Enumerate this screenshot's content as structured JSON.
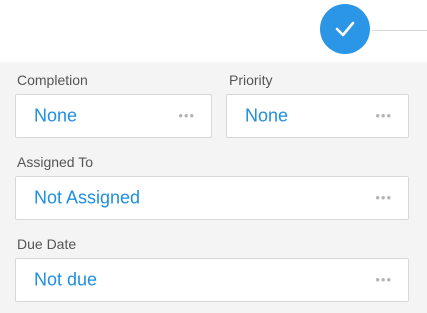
{
  "confirm": {
    "icon": "checkmark-icon",
    "color": "#2b95e6"
  },
  "fields": {
    "completion": {
      "label": "Completion",
      "value": "None",
      "more": "•••"
    },
    "priority": {
      "label": "Priority",
      "value": "None",
      "more": "•••"
    },
    "assigned_to": {
      "label": "Assigned To",
      "value": "Not Assigned",
      "more": "•••"
    },
    "due_date": {
      "label": "Due Date",
      "value": "Not due",
      "more": "•••"
    }
  },
  "colors": {
    "accent": "#1f8fe0",
    "panel_bg": "#f4f4f4",
    "label": "#555555"
  }
}
